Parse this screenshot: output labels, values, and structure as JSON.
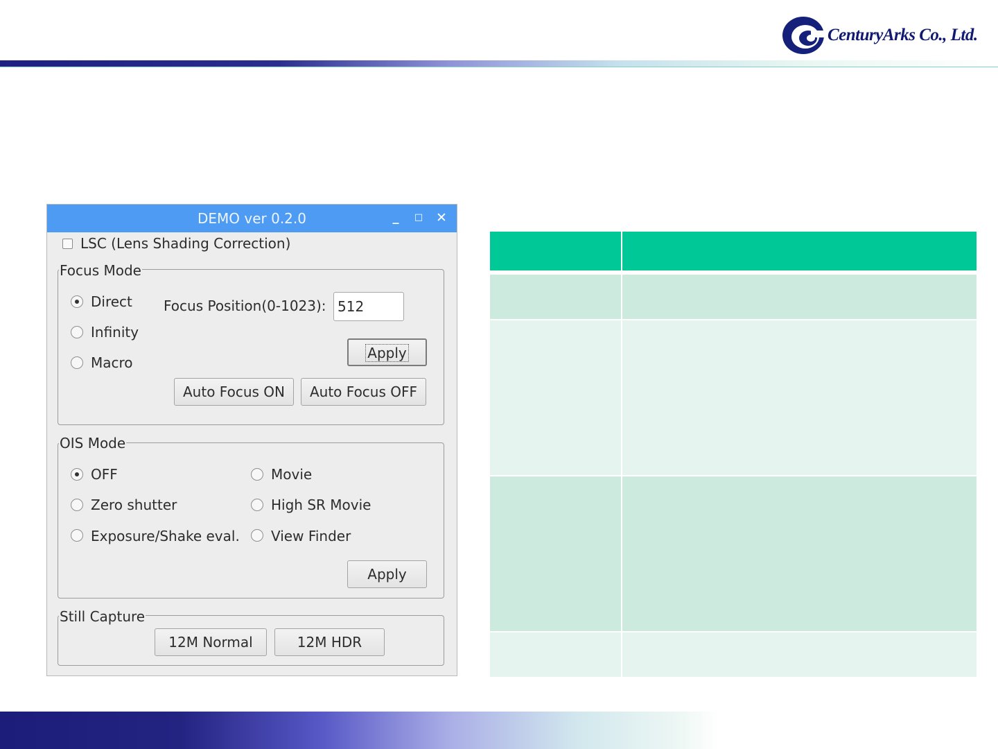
{
  "branding": {
    "company_name": "CenturyArks Co., Ltd.",
    "brand_color": "#111a70"
  },
  "window": {
    "title": "DEMO ver 0.2.0",
    "titlebar_color": "#4d9bf2",
    "controls": {
      "minimize": "_",
      "maximize": "□",
      "close": "✕"
    },
    "lsc": {
      "label": "LSC (Lens Shading Correction)",
      "checked": false
    },
    "focus_mode": {
      "legend": "Focus Mode",
      "options": [
        {
          "label": "Direct",
          "selected": true
        },
        {
          "label": "Infinity",
          "selected": false
        },
        {
          "label": "Macro",
          "selected": false
        }
      ],
      "position_label": "Focus Position(0-1023):",
      "position_value": "512",
      "apply_label": "Apply",
      "af_on_label": "Auto Focus ON",
      "af_off_label": "Auto Focus OFF"
    },
    "ois_mode": {
      "legend": "OIS Mode",
      "options": [
        {
          "label": "OFF",
          "selected": true
        },
        {
          "label": "Movie",
          "selected": false
        },
        {
          "label": "Zero shutter",
          "selected": false
        },
        {
          "label": "High SR Movie",
          "selected": false
        },
        {
          "label": "Exposure/Shake eval.",
          "selected": false
        },
        {
          "label": "View Finder",
          "selected": false
        }
      ],
      "apply_label": "Apply"
    },
    "still_capture": {
      "legend": "Still Capture",
      "normal_label": "12M Normal",
      "hdr_label": "12M HDR"
    }
  },
  "table": {
    "header_color": "#00c896",
    "row_colors": [
      "#cdeadf",
      "#e6f4ef"
    ],
    "rows": [
      {
        "type": "header",
        "col1": "",
        "col2": ""
      },
      {
        "type": "body",
        "col1": "",
        "col2": ""
      },
      {
        "type": "body",
        "col1": "",
        "col2": ""
      },
      {
        "type": "body",
        "col1": "",
        "col2": ""
      },
      {
        "type": "body",
        "col1": "",
        "col2": ""
      }
    ]
  }
}
